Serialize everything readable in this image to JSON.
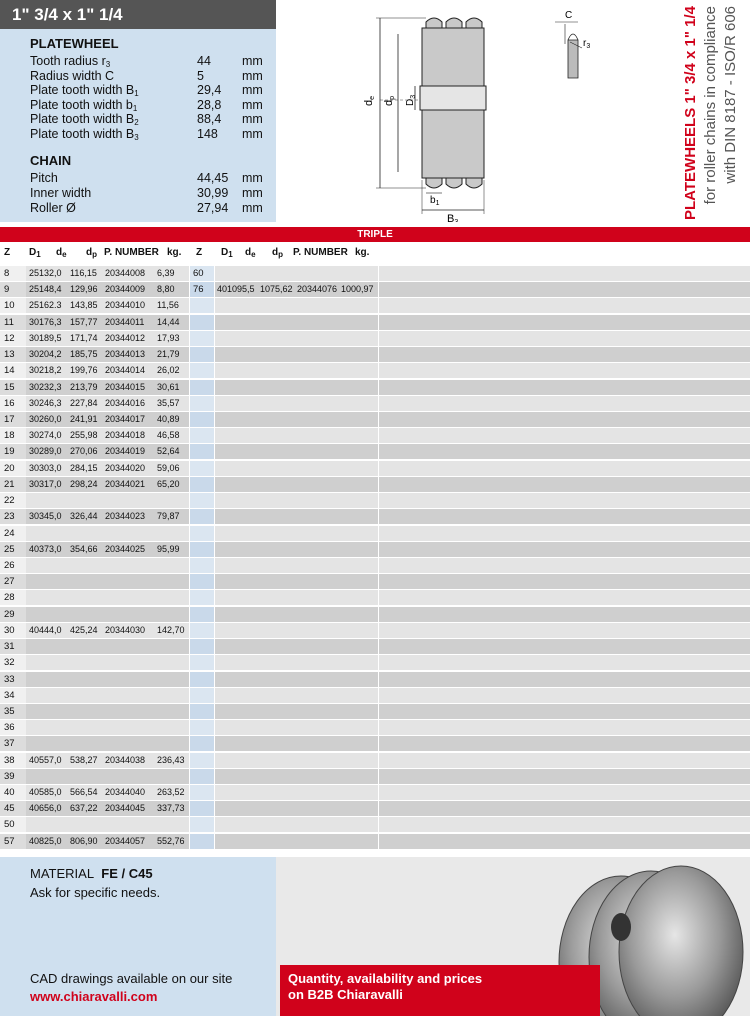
{
  "header": {
    "title": "1\" 3/4 x 1\" 1/4",
    "vertical_line1": "PLATEWHEELS  1\" 3/4 x 1\" 1/4",
    "vertical_line2": "for roller chains in compliance",
    "vertical_line3": "with DIN 8187 - ISO/R 606"
  },
  "platewheel": {
    "title": "PLATEWHEEL",
    "rows": [
      {
        "label": "Tooth radius r",
        "sub": "3",
        "value": "44",
        "unit": "mm"
      },
      {
        "label": "Radius width C",
        "sub": "",
        "value": "5",
        "unit": "mm"
      },
      {
        "label": "Plate tooth width B",
        "sub": "1",
        "value": "29,4",
        "unit": "mm"
      },
      {
        "label": "Plate tooth width b",
        "sub": "1",
        "value": "28,8",
        "unit": "mm"
      },
      {
        "label": "Plate tooth width B",
        "sub": "2",
        "value": "88,4",
        "unit": "mm"
      },
      {
        "label": "Plate tooth width B",
        "sub": "3",
        "value": "148",
        "unit": "mm"
      }
    ]
  },
  "chain": {
    "title": "CHAIN",
    "rows": [
      {
        "label": "Pitch",
        "value": "44,45",
        "unit": "mm"
      },
      {
        "label": "Inner width",
        "value": "30,99",
        "unit": "mm"
      },
      {
        "label": "Roller Ø",
        "value": "27,94",
        "unit": "mm"
      }
    ]
  },
  "diagram": {
    "de": "d",
    "de_sub": "e",
    "dp": "d",
    "dp_sub": "p",
    "D3": "D",
    "D3_sub": "3",
    "b1": "b",
    "b1_sub": "1",
    "B3": "B",
    "B3_sub": "3",
    "C": "C",
    "r3": "r",
    "r3_sub": "3"
  },
  "table": {
    "band_label": "TRIPLE",
    "headers": {
      "z": "Z",
      "d1": "D",
      "d1_sub": "1",
      "de": "d",
      "de_sub": "e",
      "dp": "d",
      "dp_sub": "p",
      "pn": "P. NUMBER",
      "kg": "kg."
    },
    "rows": [
      {
        "z": "8",
        "d1": "25",
        "de": "132,0",
        "dp": "116,15",
        "pn": "20344008",
        "kg": "6,39",
        "z2": "60",
        "d1b": "",
        "deb": "",
        "dpb": "",
        "pnb": "",
        "kgb": ""
      },
      {
        "z": "9",
        "d1": "25",
        "de": "148,4",
        "dp": "129,96",
        "pn": "20344009",
        "kg": "8,80",
        "z2": "76",
        "d1b": "40",
        "deb": "1095,5",
        "dpb": "1075,62",
        "pnb": "20344076",
        "kgb": "1000,97"
      },
      {
        "z": "10",
        "d1": "25",
        "de": "162.3",
        "dp": "143,85",
        "pn": "20344010",
        "kg": "11,56"
      },
      {
        "z": "11",
        "d1": "30",
        "de": "176,3",
        "dp": "157,77",
        "pn": "20344011",
        "kg": "14,44"
      },
      {
        "z": "12",
        "d1": "30",
        "de": "189,5",
        "dp": "171,74",
        "pn": "20344012",
        "kg": "17,93"
      },
      {
        "z": "13",
        "d1": "30",
        "de": "204,2",
        "dp": "185,75",
        "pn": "20344013",
        "kg": "21,79"
      },
      {
        "z": "14",
        "d1": "30",
        "de": "218,2",
        "dp": "199,76",
        "pn": "20344014",
        "kg": "26,02"
      },
      {
        "z": "15",
        "d1": "30",
        "de": "232,3",
        "dp": "213,79",
        "pn": "20344015",
        "kg": "30,61"
      },
      {
        "z": "16",
        "d1": "30",
        "de": "246,3",
        "dp": "227,84",
        "pn": "20344016",
        "kg": "35,57"
      },
      {
        "z": "17",
        "d1": "30",
        "de": "260,0",
        "dp": "241,91",
        "pn": "20344017",
        "kg": "40,89"
      },
      {
        "z": "18",
        "d1": "30",
        "de": "274,0",
        "dp": "255,98",
        "pn": "20344018",
        "kg": "46,58"
      },
      {
        "z": "19",
        "d1": "30",
        "de": "289,0",
        "dp": "270,06",
        "pn": "20344019",
        "kg": "52,64"
      },
      {
        "z": "20",
        "d1": "30",
        "de": "303,0",
        "dp": "284,15",
        "pn": "20344020",
        "kg": "59,06"
      },
      {
        "z": "21",
        "d1": "30",
        "de": "317,0",
        "dp": "298,24",
        "pn": "20344021",
        "kg": "65,20"
      },
      {
        "z": "22"
      },
      {
        "z": "23",
        "d1": "30",
        "de": "345,0",
        "dp": "326,44",
        "pn": "20344023",
        "kg": "79,87"
      },
      {
        "z": "24"
      },
      {
        "z": "25",
        "d1": "40",
        "de": "373,0",
        "dp": "354,66",
        "pn": "20344025",
        "kg": "95,99"
      },
      {
        "z": "26"
      },
      {
        "z": "27"
      },
      {
        "z": "28"
      },
      {
        "z": "29"
      },
      {
        "z": "30",
        "d1": "40",
        "de": "444,0",
        "dp": "425,24",
        "pn": "20344030",
        "kg": "142,70"
      },
      {
        "z": "31"
      },
      {
        "z": "32"
      },
      {
        "z": "33"
      },
      {
        "z": "34"
      },
      {
        "z": "35"
      },
      {
        "z": "36"
      },
      {
        "z": "37"
      },
      {
        "z": "38",
        "d1": "40",
        "de": "557,0",
        "dp": "538,27",
        "pn": "20344038",
        "kg": "236,43"
      },
      {
        "z": "39"
      },
      {
        "z": "40",
        "d1": "40",
        "de": "585,0",
        "dp": "566,54",
        "pn": "20344040",
        "kg": "263,52"
      },
      {
        "z": "45",
        "d1": "40",
        "de": "656,0",
        "dp": "637,22",
        "pn": "20344045",
        "kg": "337,73"
      },
      {
        "z": "50"
      },
      {
        "z": "57",
        "d1": "40",
        "de": "825,0",
        "dp": "806,90",
        "pn": "20344057",
        "kg": "552,76"
      }
    ]
  },
  "footer": {
    "material_label": "MATERIAL",
    "material_value": "FE / C45",
    "ask": "Ask for specific needs.",
    "cad": "CAD drawings available on our site",
    "website": "www.chiaravalli.com",
    "b2b_line1": "Quantity, availability and prices",
    "b2b_line2": "on B2B Chiaravalli"
  },
  "colors": {
    "accent_red": "#d0021b",
    "panel_blue": "#cfe0ef",
    "title_grey": "#555555"
  }
}
